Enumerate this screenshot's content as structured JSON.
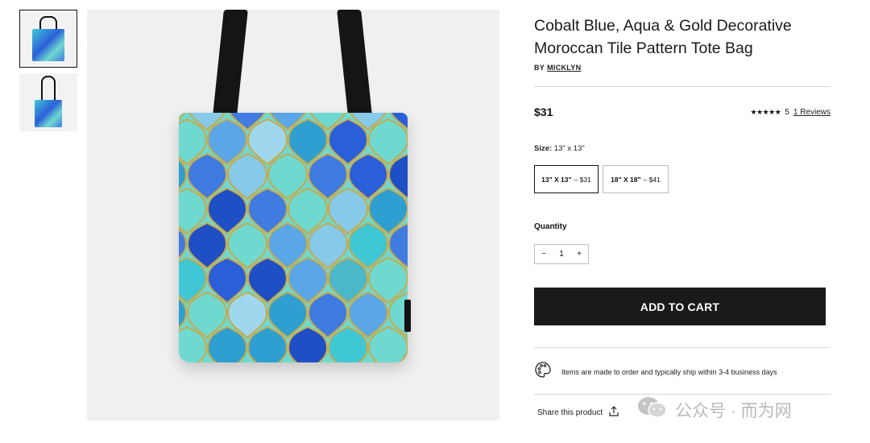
{
  "product": {
    "title": "Cobalt Blue, Aqua & Gold Decorative Moroccan Tile Pattern Tote Bag",
    "by_prefix": "BY",
    "artist": "MICKLYN",
    "price": "$31",
    "stars": "★★★★★",
    "rating_value": "5",
    "reviews_link": "1 Reviews"
  },
  "size": {
    "label_prefix": "Size:",
    "selected_value": "13\" x 13\"",
    "options": [
      {
        "label": "13\" X 13\"",
        "price": "– $31",
        "selected": true
      },
      {
        "label": "18\" X 18\"",
        "price": "– $41",
        "selected": false
      }
    ]
  },
  "quantity": {
    "label": "Quantity",
    "minus": "−",
    "value": "1",
    "plus": "+"
  },
  "cart": {
    "add_label": "ADD TO CART"
  },
  "shipping": {
    "icon": "palette-icon",
    "text": "Items are made to order and typically ship within 3-4 business days"
  },
  "share": {
    "label": "Share this product",
    "icon": "share-upload-icon"
  },
  "watermark": {
    "text": "公众号 · 而为网",
    "icon": "wechat-icon"
  },
  "colors": {
    "cart_button": "#1a1a1a",
    "tile_palette": [
      "#2b5fd9",
      "#3f7be0",
      "#5aa6e6",
      "#3fc7d6",
      "#6fd9cf",
      "#86c9e8",
      "#2e9fd0",
      "#9fd8ee",
      "#4bb8c9",
      "#1f4fc4"
    ],
    "tile_border": "#c9a94a"
  }
}
